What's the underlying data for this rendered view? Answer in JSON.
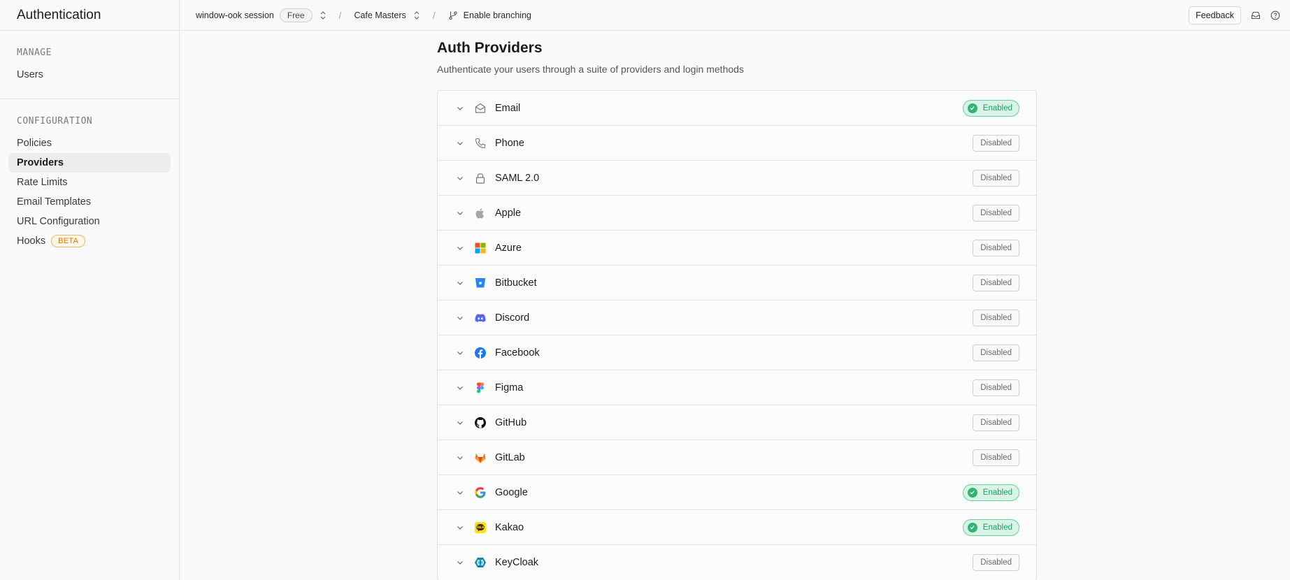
{
  "sidebar": {
    "title": "Authentication",
    "sections": [
      {
        "title": "MANAGE",
        "items": [
          {
            "label": "Users"
          }
        ]
      },
      {
        "title": "CONFIGURATION",
        "items": [
          {
            "label": "Policies"
          },
          {
            "label": "Providers"
          },
          {
            "label": "Rate Limits"
          },
          {
            "label": "Email Templates"
          },
          {
            "label": "URL Configuration"
          },
          {
            "label": "Hooks",
            "badge": "BETA"
          }
        ]
      }
    ],
    "active_item": "Providers"
  },
  "topbar": {
    "org": "window-ook session",
    "plan": "Free",
    "project": "Cafe Masters",
    "branch": "Enable branching",
    "separator": "/",
    "feedback_label": "Feedback"
  },
  "main": {
    "title": "Auth Providers",
    "description": "Authenticate your users through a suite of providers and login methods",
    "providers": [
      {
        "name": "Email",
        "status": "Enabled",
        "icon": "envelope-icon"
      },
      {
        "name": "Phone",
        "status": "Disabled",
        "icon": "phone-icon"
      },
      {
        "name": "SAML 2.0",
        "status": "Disabled",
        "icon": "lock-icon"
      },
      {
        "name": "Apple",
        "status": "Disabled",
        "icon": "apple-icon"
      },
      {
        "name": "Azure",
        "status": "Disabled",
        "icon": "azure-icon"
      },
      {
        "name": "Bitbucket",
        "status": "Disabled",
        "icon": "bitbucket-icon"
      },
      {
        "name": "Discord",
        "status": "Disabled",
        "icon": "discord-icon"
      },
      {
        "name": "Facebook",
        "status": "Disabled",
        "icon": "facebook-icon"
      },
      {
        "name": "Figma",
        "status": "Disabled",
        "icon": "figma-icon"
      },
      {
        "name": "GitHub",
        "status": "Disabled",
        "icon": "github-icon"
      },
      {
        "name": "GitLab",
        "status": "Disabled",
        "icon": "gitlab-icon"
      },
      {
        "name": "Google",
        "status": "Enabled",
        "icon": "google-icon"
      },
      {
        "name": "Kakao",
        "status": "Enabled",
        "icon": "kakao-icon"
      },
      {
        "name": "KeyCloak",
        "status": "Disabled",
        "icon": "keycloak-icon"
      }
    ]
  },
  "colors": {
    "enabled_text": "#1f9d63",
    "enabled_bg": "#d8f4e6",
    "beta": "#d97706"
  }
}
